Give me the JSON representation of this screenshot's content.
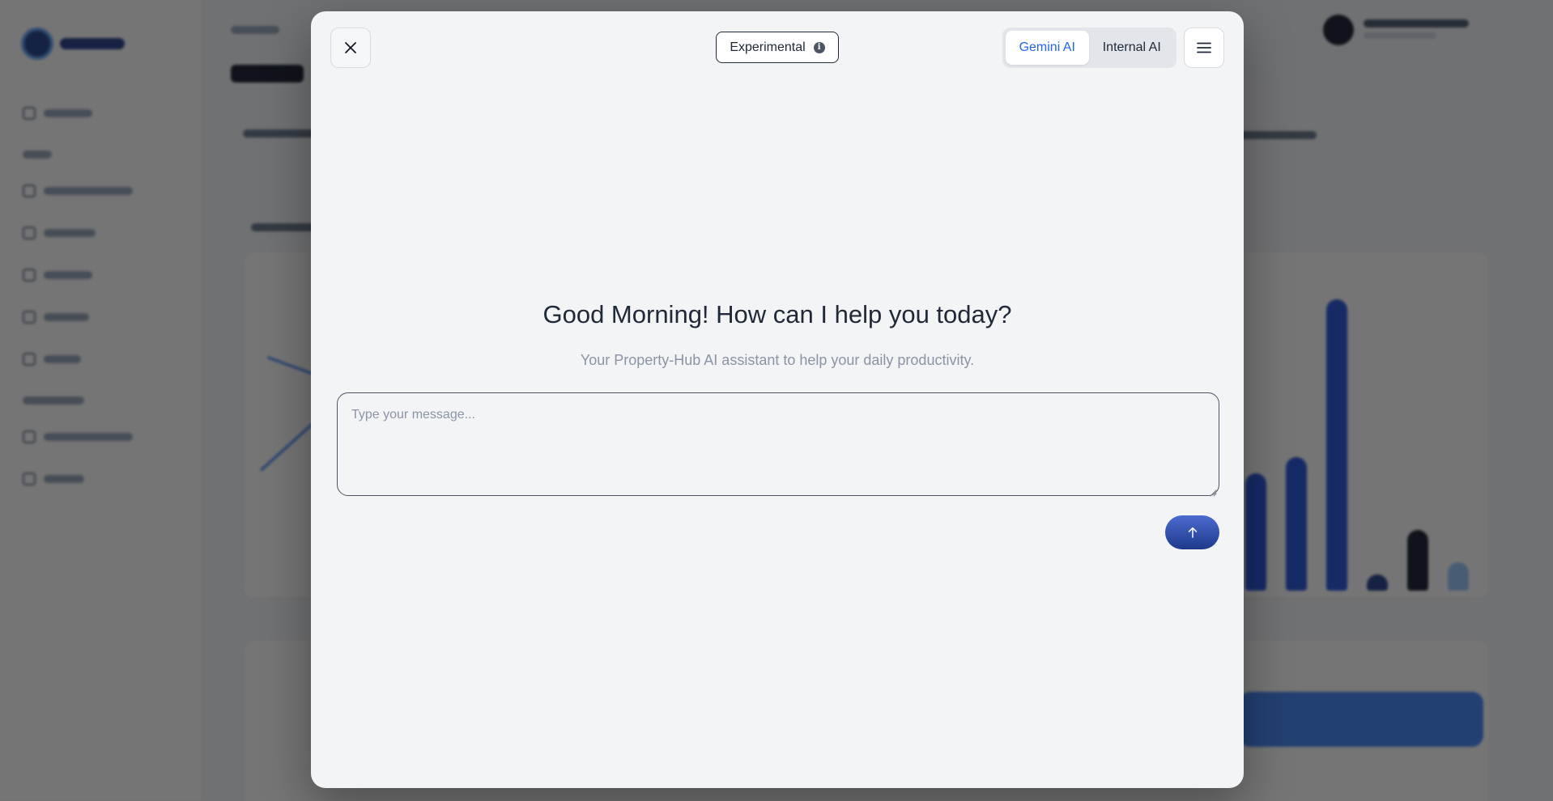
{
  "modal": {
    "experimental_label": "Experimental",
    "ai_options": [
      {
        "label": "Gemini AI",
        "active": true
      },
      {
        "label": "Internal AI",
        "active": false
      }
    ],
    "greeting": "Good Morning! How can I help you today?",
    "subtitle": "Your Property-Hub AI assistant to help your daily productivity.",
    "message_placeholder": "Type your message...",
    "icons": {
      "close": "close-icon",
      "info": "info-icon",
      "menu": "hamburger-menu-icon",
      "send": "arrow-up-icon"
    }
  },
  "colors": {
    "accent": "#2563eb",
    "send_button": "#1e3a8a",
    "overlay": "rgba(17,17,17,0.58)"
  }
}
